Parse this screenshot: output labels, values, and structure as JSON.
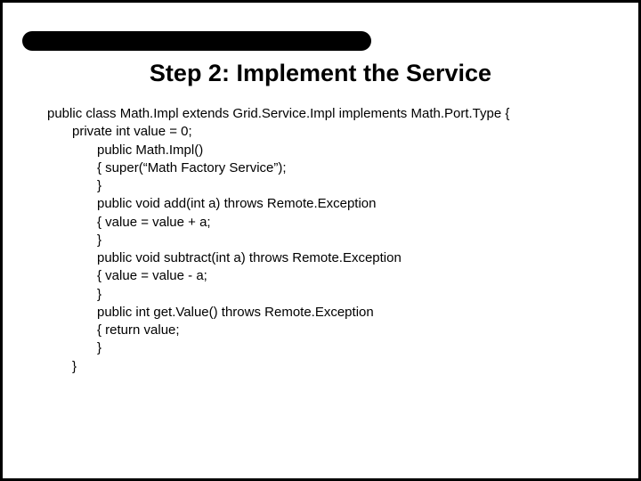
{
  "title": {
    "step": "Step 2:",
    "rest": "  Implement the Service"
  },
  "code": {
    "line1": "public class Math.Impl extends Grid.Service.Impl implements Math.Port.Type  {",
    "line2": "private int value = 0;",
    "line3": "",
    "line4": "public Math.Impl()",
    "line5": "{  super(“Math Factory Service”);",
    "line6": "}",
    "line7": "public void add(int a) throws Remote.Exception",
    "line8": "{ value = value + a;",
    "line9": "}",
    "line10": "public void subtract(int a) throws Remote.Exception",
    "line11": "{ value = value - a;",
    "line12": "}",
    "line13": "public int get.Value() throws Remote.Exception",
    "line14": "{ return value;",
    "line15": "}",
    "line16": "}"
  }
}
